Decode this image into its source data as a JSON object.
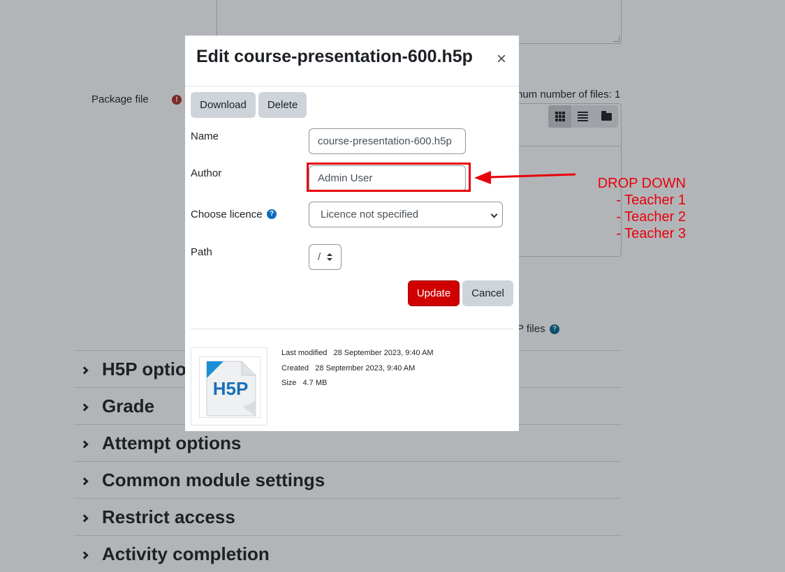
{
  "background": {
    "package_file_label": "Package file",
    "max_files_text": "num number of files: 1",
    "h5p_files_text": "P files",
    "sections": [
      {
        "title": "H5P optio"
      },
      {
        "title": "Grade"
      },
      {
        "title": "Attempt options"
      },
      {
        "title": "Common module settings"
      },
      {
        "title": "Restrict access"
      },
      {
        "title": "Activity completion"
      }
    ]
  },
  "modal": {
    "title": "Edit course-presentation-600.h5p",
    "close_glyph": "×",
    "download_label": "Download",
    "delete_label": "Delete",
    "name_label": "Name",
    "name_value": "course-presentation-600.h5p",
    "author_label": "Author",
    "author_value": "Admin User",
    "licence_label": "Choose licence",
    "licence_selected": "Licence not specified",
    "path_label": "Path",
    "path_value": "/",
    "update_label": "Update",
    "cancel_label": "Cancel",
    "thumbnail_text": "H5P",
    "meta": {
      "last_modified_label": "Last modified",
      "last_modified_value": "28 September 2023, 9:40 AM",
      "created_label": "Created",
      "created_value": "28 September 2023, 9:40 AM",
      "size_label": "Size",
      "size_value": "4.7 MB"
    }
  },
  "annotation": {
    "lines": [
      "DROP DOWN",
      "- Teacher 1",
      "- Teacher 2",
      "- Teacher 3"
    ],
    "color": "#e8000b"
  },
  "colors": {
    "overlay_bg": "#b2b5b8",
    "primary": "#d00000",
    "secondary": "#ced4da"
  }
}
